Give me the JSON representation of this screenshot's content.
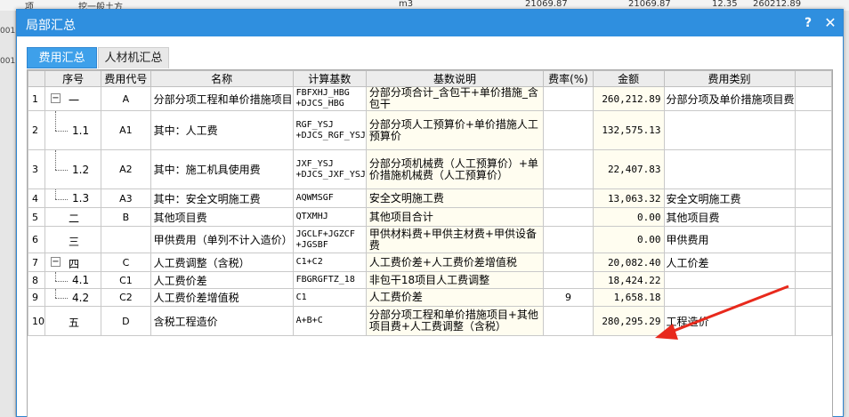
{
  "background": {
    "row_text": [
      "项",
      "挖一般土方",
      "m3",
      "21069.87",
      "21069.87",
      "12.35",
      "260212.89"
    ],
    "left_labels": [
      "001",
      "001"
    ]
  },
  "dialog": {
    "title": "局部汇总",
    "help_label": "?",
    "close_label": "✕"
  },
  "tabs": [
    {
      "label": "费用汇总",
      "active": true
    },
    {
      "label": "人材机汇总",
      "active": false
    }
  ],
  "columns": [
    "序号",
    "费用代号",
    "名称",
    "计算基数",
    "基数说明",
    "费率(%)",
    "金额",
    "费用类别"
  ],
  "rows": [
    {
      "rn": "1",
      "tree": "一",
      "toggle": "−",
      "code": "A",
      "name": "分部分项工程和单价措施项目",
      "base": "FBFXHJ_HBG +DJCS_HBG",
      "desc": "分部分项合计_含包干+单价措施_含包干",
      "rate": "",
      "amount": "260,212.89",
      "category": "分部分项及单价措施项目费"
    },
    {
      "rn": "2",
      "tree": "1.1",
      "toggle": "",
      "code": "A1",
      "name": "其中：人工费",
      "base": "RGF_YSJ +DJCS_RGF_YSJ",
      "desc": "分部分项人工预算价+单价措施人工预算价",
      "rate": "",
      "amount": "132,575.13",
      "category": ""
    },
    {
      "rn": "3",
      "tree": "1.2",
      "toggle": "",
      "code": "A2",
      "name": "其中：施工机具使用费",
      "base": "JXF_YSJ +DJCS_JXF_YSJ",
      "desc": "分部分项机械费（人工预算价）+单价措施机械费（人工预算价）",
      "rate": "",
      "amount": "22,407.83",
      "category": ""
    },
    {
      "rn": "4",
      "tree": "1.3",
      "toggle": "",
      "code": "A3",
      "name": "其中：安全文明施工费",
      "base": "AQWMSGF",
      "desc": "安全文明施工费",
      "rate": "",
      "amount": "13,063.32",
      "category": "安全文明施工费"
    },
    {
      "rn": "5",
      "tree": "二",
      "toggle": "",
      "code": "B",
      "name": "其他项目费",
      "base": "QTXMHJ",
      "desc": "其他项目合计",
      "rate": "",
      "amount": "0.00",
      "category": "其他项目费"
    },
    {
      "rn": "6",
      "tree": "三",
      "toggle": "",
      "code": "",
      "name": "甲供费用（单列不计入造价）",
      "base": "JGCLF+JGZCF +JGSBF",
      "desc": "甲供材料费+甲供主材费+甲供设备费",
      "rate": "",
      "amount": "0.00",
      "category": "甲供费用"
    },
    {
      "rn": "7",
      "tree": "四",
      "toggle": "−",
      "code": "C",
      "name": "人工费调整（含税）",
      "base": "C1+C2",
      "desc": "人工费价差+人工费价差增值税",
      "rate": "",
      "amount": "20,082.40",
      "category": "人工价差"
    },
    {
      "rn": "8",
      "tree": "4.1",
      "toggle": "",
      "code": "C1",
      "name": "人工费价差",
      "base": "FBGRGFTZ_18",
      "desc": "非包干18项目人工费调整",
      "rate": "",
      "amount": "18,424.22",
      "category": ""
    },
    {
      "rn": "9",
      "tree": "4.2",
      "toggle": "",
      "code": "C2",
      "name": "人工费价差增值税",
      "base": "C1",
      "desc": "人工费价差",
      "rate": "9",
      "amount": "1,658.18",
      "category": ""
    },
    {
      "rn": "10",
      "tree": "五",
      "toggle": "",
      "code": "D",
      "name": "含税工程造价",
      "base": "A+B+C",
      "desc": "分部分项工程和单价措施项目+其他项目费+人工费调整（含税）",
      "rate": "",
      "amount": "280,295.29",
      "category": "工程造价"
    }
  ],
  "colors": {
    "accent": "#2f8fdf",
    "annotation_arrow": "#e8291c"
  }
}
